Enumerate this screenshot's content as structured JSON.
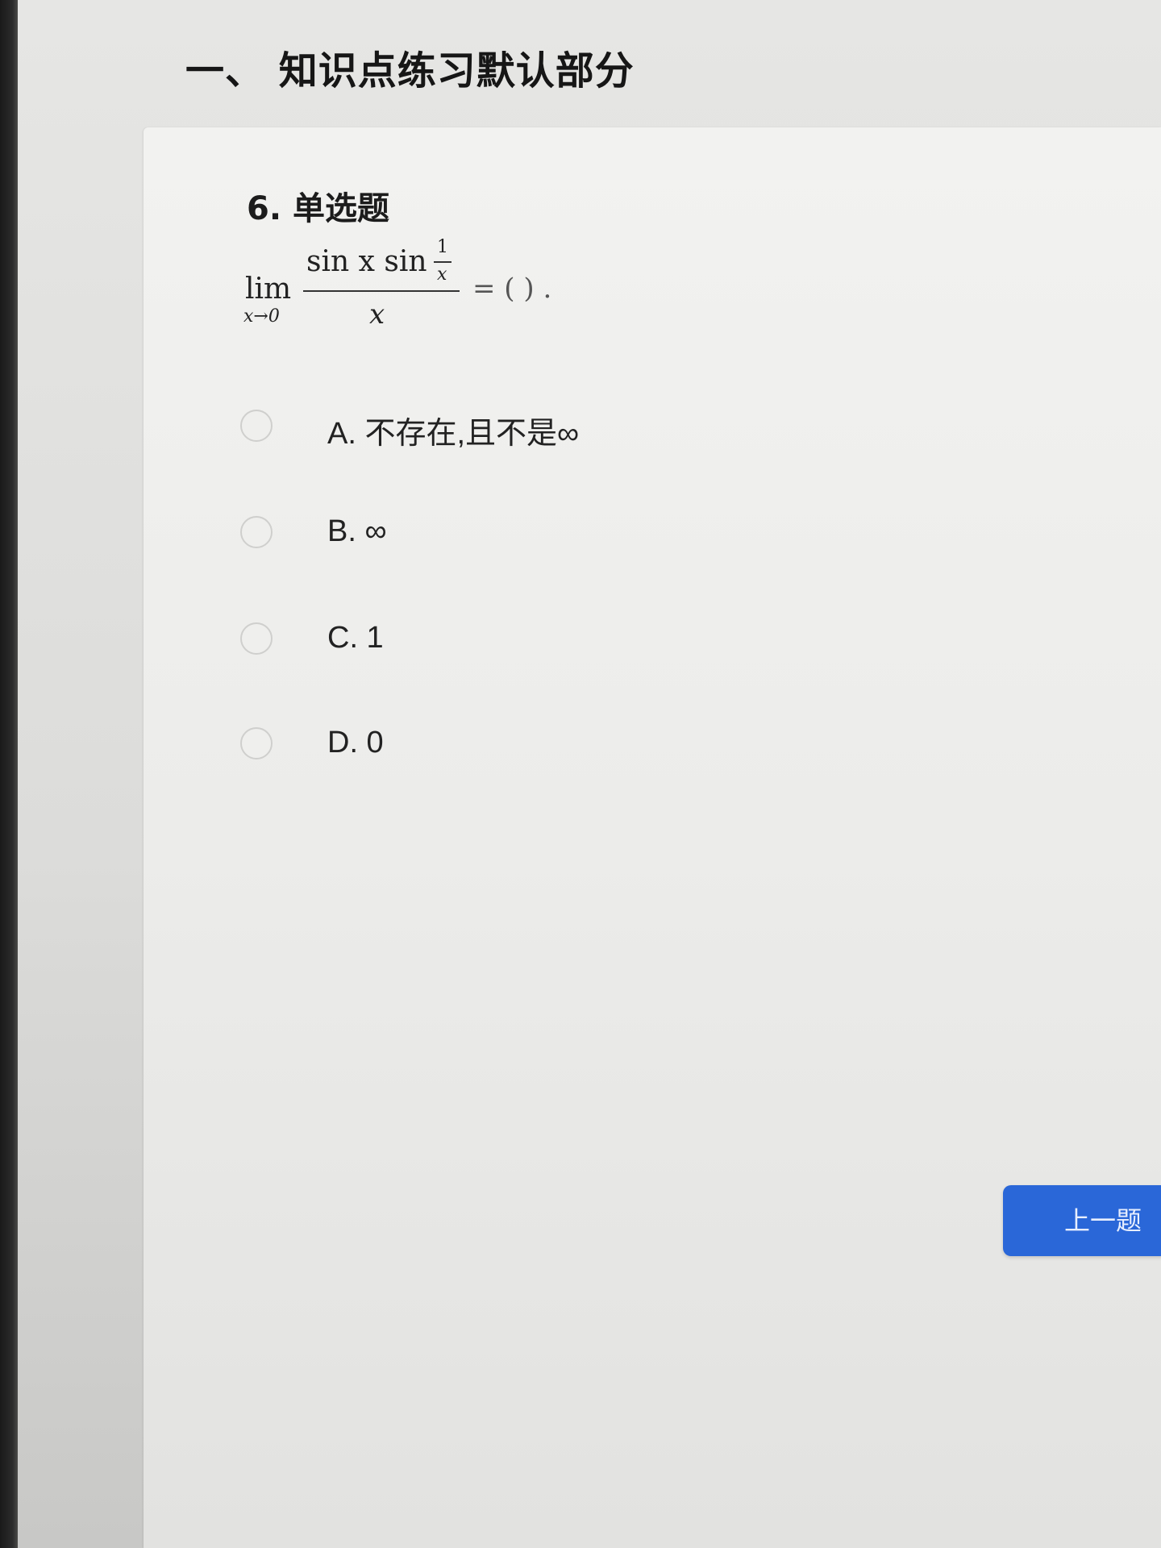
{
  "section": {
    "title": "一、 知识点练习默认部分"
  },
  "question": {
    "header": "6. 单选题",
    "formula": {
      "lim": "lim",
      "lim_sub": "x→0",
      "numerator": "sin x sin",
      "inner_numerator": "1",
      "inner_denominator": "x",
      "denominator": "x",
      "suffix": "= ( ) ."
    },
    "options": [
      {
        "label": "A. 不存在,且不是∞"
      },
      {
        "label": "B. ∞"
      },
      {
        "label": "C. 1"
      },
      {
        "label": "D. 0"
      }
    ]
  },
  "navigation": {
    "prev_label": "上一题"
  },
  "colors": {
    "accent": "#2a67d8",
    "card_background": "#f0f0ee",
    "text": "#1c1c1c"
  }
}
